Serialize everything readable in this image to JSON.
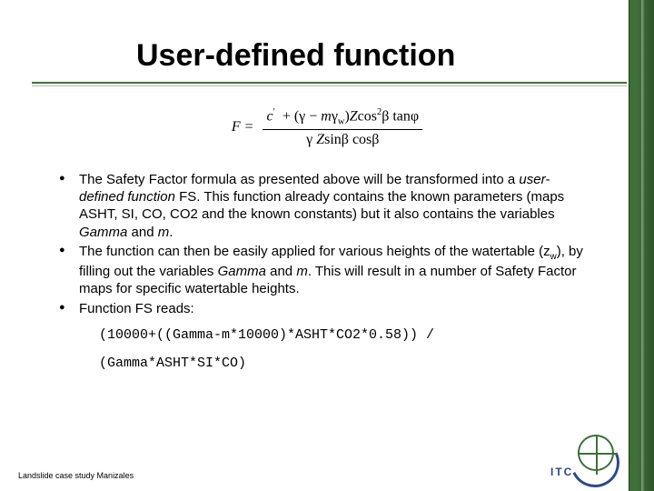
{
  "title": "User-defined function",
  "formula": {
    "lhs": "F =",
    "numerator": "c′ + (γ − mγ_w) Z cos²β tanφ",
    "denominator": "γ Z sinβ cosβ"
  },
  "bullets": [
    {
      "text_parts": [
        "The Safety Factor formula as presented above will be transformed into a ",
        "user-defined function",
        " FS. This function already contains the known parameters (maps ASHT, SI, CO, CO2 and the known constants) but it also contains the variables ",
        "Gamma",
        " and ",
        "m",
        "."
      ]
    },
    {
      "text_parts": [
        "The function can then be easily applied for various heights of the watertable (z",
        "w",
        "), by filling out the variables ",
        "Gamma",
        " and ",
        "m",
        ". This will result in a number of Safety Factor maps for specific watertable heights."
      ]
    },
    {
      "text_parts": [
        "Function FS reads:"
      ],
      "code": [
        "(10000+((Gamma-m*10000)*ASHT*CO2*0.58)) /",
        "(Gamma*ASHT*SI*CO)"
      ]
    }
  ],
  "footer": "Landslide case study Manizales",
  "logo_text": "ITC"
}
